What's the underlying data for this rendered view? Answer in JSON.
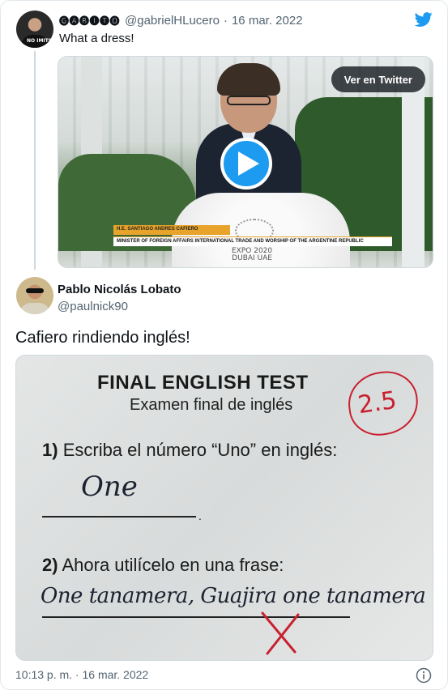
{
  "quoted_tweet": {
    "author_name": "🅖🅐🅑🅘🅣🅞",
    "handle": "@gabrielHLucero",
    "separator": "·",
    "date": "16 mar. 2022",
    "text": "What a dress!",
    "avatar_shirt_text": "NO IMITS",
    "video": {
      "view_on_twitter_label": "Ver en Twitter",
      "lower_third_name": "H.E. SANTIAGO ANDRES CAFIERO",
      "lower_third_title": "MINISTER OF FOREIGN AFFAIRS INTERNATIONAL TRADE AND WORSHIP OF THE ARGENTINE REPUBLIC",
      "podium_text": "EXPO 2020\nDUBAI UAE"
    }
  },
  "tweet": {
    "author_name": "Pablo Nicolás Lobato",
    "handle": "@paulnick90",
    "text": "Cafiero rindiendo inglés!",
    "image": {
      "title": "FINAL ENGLISH TEST",
      "subtitle": "Examen final de inglés",
      "grade": "2.5",
      "q1_number": "1)",
      "q1_text": "Escriba el número “Uno” en inglés:",
      "a1": "One",
      "q2_number": "2)",
      "q2_text": "Ahora utilícelo en una frase:",
      "a2": "One tanamera, Guajira one tanamera"
    },
    "timestamp": "10:13 p. m. · 16 mar. 2022"
  },
  "icons": {
    "brand": "twitter-bird-icon",
    "play": "play-icon",
    "info": "info-icon"
  },
  "colors": {
    "accent": "#1d9bf0",
    "secondary_text": "#536471",
    "grade_red": "#c8202f"
  }
}
